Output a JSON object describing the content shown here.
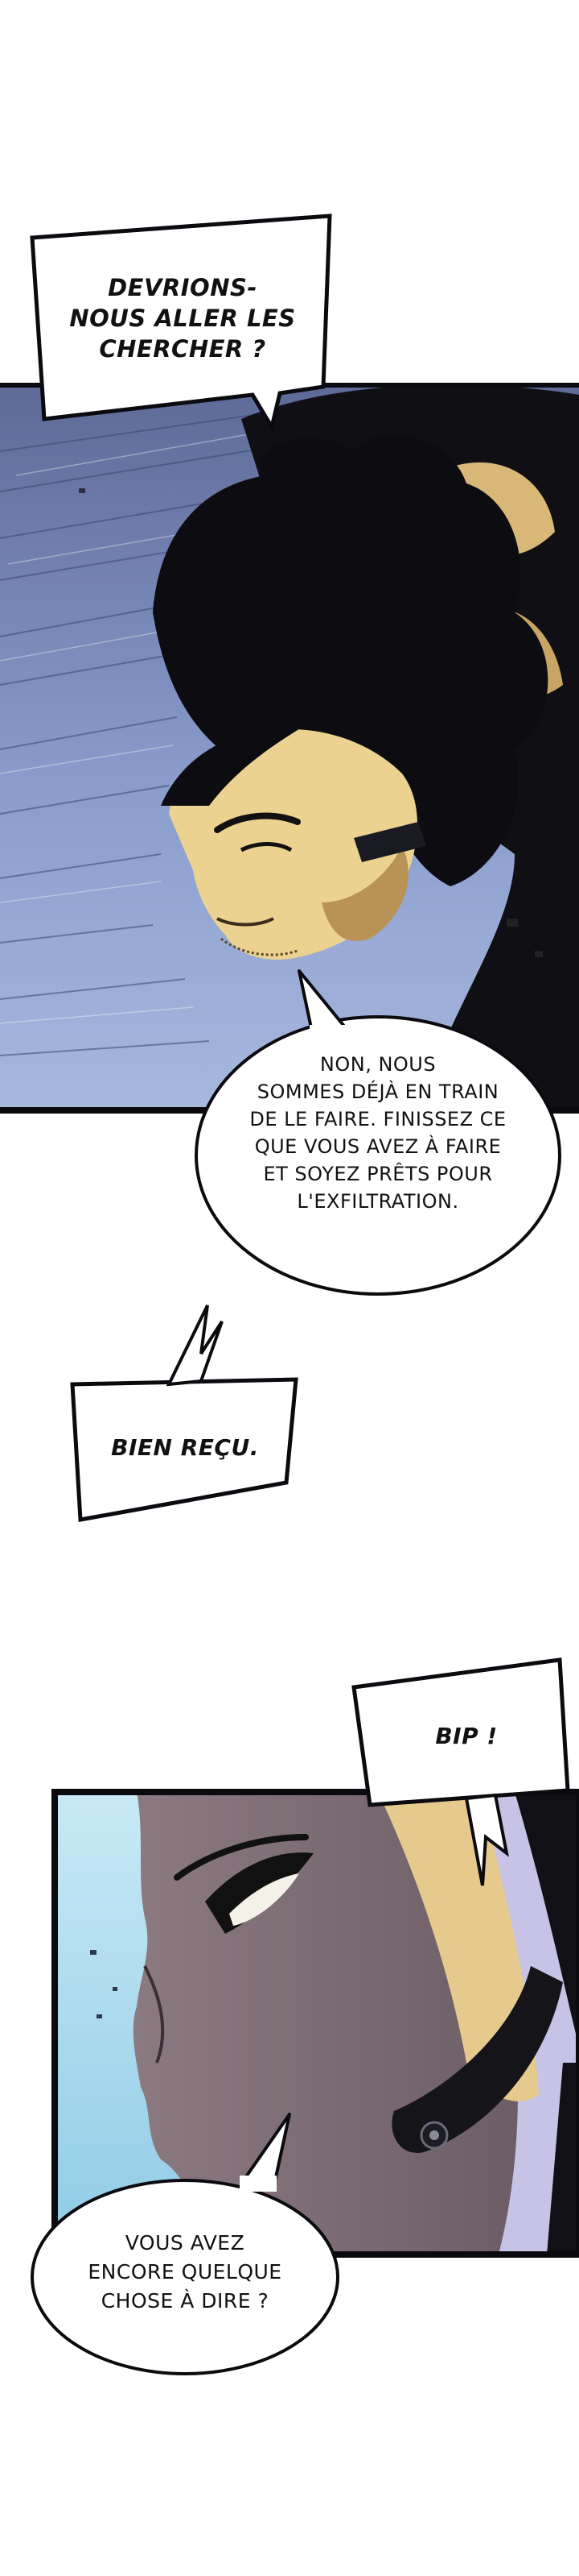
{
  "page": {
    "background": "#ffffff"
  },
  "palette": {
    "ink": "#0b0b0f",
    "sky_light": "#9fb2d8",
    "sky_dark": "#5c6894",
    "skin": "#e9cf8a",
    "skin_shadow": "#b38e57",
    "face_shade": "#7b6a72",
    "cyan_sky": "#a9d8ee",
    "lavender_bg": "#c9c7e8",
    "hair": "#101015",
    "bubble_fill": "#ffffff"
  },
  "speech": [
    {
      "id": "devrions",
      "lines": [
        "DEVRIONS-",
        "NOUS ALLER LES",
        "CHERCHER ?"
      ]
    },
    {
      "id": "non-nous",
      "lines": [
        "NON, NOUS",
        "SOMMES DÉJÀ EN TRAIN",
        "DE LE FAIRE. FINISSEZ CE",
        "QUE VOUS AVEZ À FAIRE",
        "ET SOYEZ PRÊTS POUR",
        "L'EXFILTRATION."
      ]
    },
    {
      "id": "bien-recu",
      "lines": [
        "BIEN REÇU."
      ]
    },
    {
      "id": "bip",
      "lines": [
        "BIP !"
      ]
    },
    {
      "id": "vous-avez",
      "lines": [
        "VOUS AVEZ",
        "ENCORE QUELQUE",
        "CHOSE À DIRE ?"
      ]
    }
  ]
}
